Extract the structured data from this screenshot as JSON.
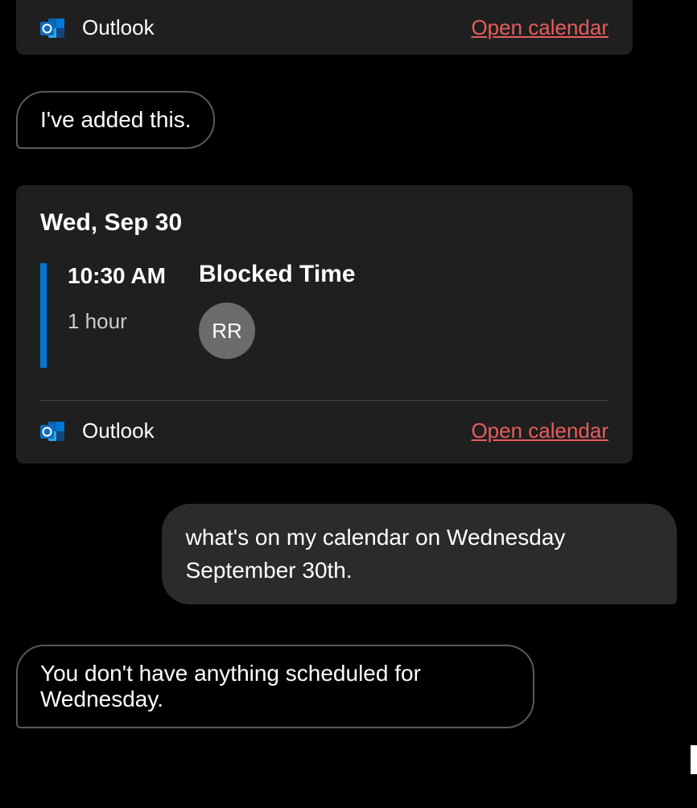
{
  "cards": {
    "card1": {
      "brand_label": "Outlook",
      "link_label": "Open calendar"
    },
    "card2": {
      "date_header": "Wed, Sep 30",
      "event": {
        "time": "10:30 AM",
        "duration": "1 hour",
        "title": "Blocked Time",
        "avatar_initials": "RR"
      },
      "brand_label": "Outlook",
      "link_label": "Open calendar"
    }
  },
  "messages": {
    "bot1": "I've added this.",
    "user1": "what's on my calendar on Wednesday September 30th.",
    "bot2": "You don't have anything scheduled for Wednesday."
  },
  "colors": {
    "accent_blue": "#0078d4",
    "link_red": "#e85c5c",
    "card_bg": "#1f1f1f",
    "user_bubble_bg": "#2b2b2b",
    "avatar_bg": "#6b6b6b"
  }
}
